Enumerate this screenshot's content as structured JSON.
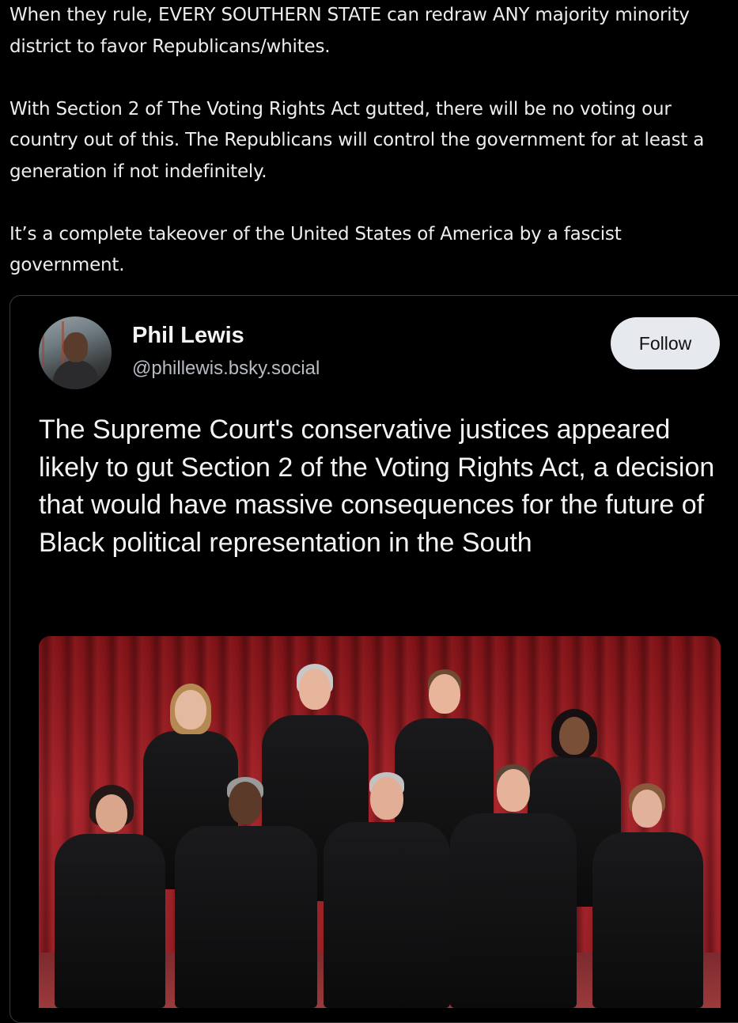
{
  "post": {
    "paragraphs": [
      "When they rule, EVERY SOUTHERN STATE can redraw ANY majority minority district to favor Republicans/whites.",
      "With Section 2 of The Voting Rights Act gutted, there will be no voting our country out of this. The Republicans will control the government for at least a generation if not indefinitely.",
      "It’s a complete takeover of the United States of America by a fascist government."
    ]
  },
  "quoted_post": {
    "author_name": "Phil Lewis",
    "handle": "@phillewis.bsky.social",
    "follow_label": "Follow",
    "text": "The Supreme Court's conservative justices appeared likely to gut Section 2 of the Voting Rights Act, a decision that would have massive consequences for the future of Black political representation in the South",
    "avatar_icon": "profile-photo",
    "image_description_icon": "group-photo"
  },
  "colors": {
    "background": "#000000",
    "text": "#ededed",
    "handle": "#b6bcc2",
    "follow_button_bg": "#e6eaef",
    "curtain": "#a3232a"
  }
}
